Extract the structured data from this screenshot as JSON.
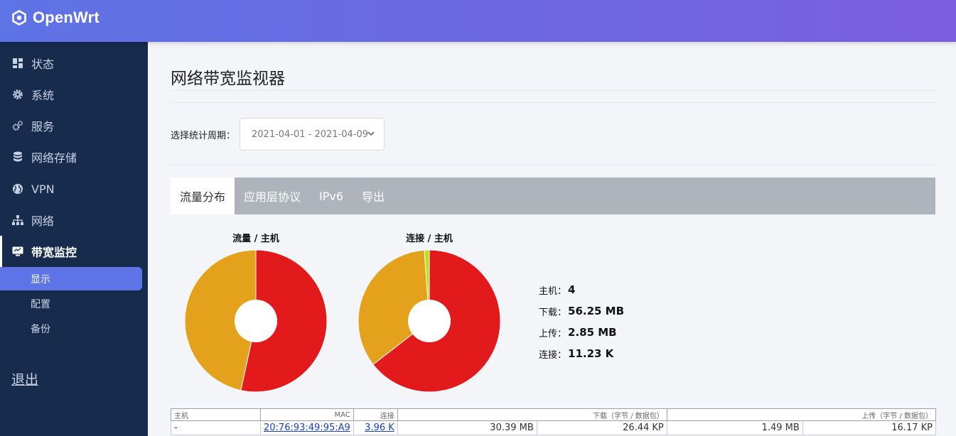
{
  "app": {
    "brand": "OpenWrt"
  },
  "sidebar": {
    "items": [
      {
        "label": "状态",
        "icon": "dashboard-icon"
      },
      {
        "label": "系统",
        "icon": "gear-icon"
      },
      {
        "label": "服务",
        "icon": "gears-icon"
      },
      {
        "label": "网络存储",
        "icon": "database-icon"
      },
      {
        "label": "VPN",
        "icon": "globe-icon"
      },
      {
        "label": "网络",
        "icon": "sitemap-icon"
      },
      {
        "label": "带宽监控",
        "icon": "monitor-icon"
      }
    ],
    "sub_items": [
      {
        "label": "显示"
      },
      {
        "label": "配置"
      },
      {
        "label": "备份"
      }
    ],
    "logout": "退出"
  },
  "page": {
    "title": "网络带宽监视器",
    "period_label": "选择统计周期：",
    "period_value": "2021-04-01 - 2021-04-09",
    "tabs": [
      {
        "label": "流量分布"
      },
      {
        "label": "应用层协议"
      },
      {
        "label": "IPv6"
      },
      {
        "label": "导出"
      }
    ]
  },
  "chart_data": [
    {
      "type": "pie",
      "title": "流量 / 主机",
      "donut": true,
      "slices": [
        {
          "value": 53.4,
          "color": "#e31a1c"
        },
        {
          "value": 46.6,
          "color": "#e4a11b"
        }
      ]
    },
    {
      "type": "pie",
      "title": "连接 / 主机",
      "donut": true,
      "slices": [
        {
          "value": 64.5,
          "color": "#e31a1c"
        },
        {
          "value": 34.4,
          "color": "#e4a11b"
        },
        {
          "value": 1.1,
          "color": "#b5e21b"
        }
      ]
    }
  ],
  "stats": [
    {
      "label": "主机：",
      "value": "4"
    },
    {
      "label": "下载：",
      "value": "56.25 MB"
    },
    {
      "label": "上传：",
      "value": "2.85 MB"
    },
    {
      "label": "连接：",
      "value": "11.23 K"
    }
  ],
  "table": {
    "headers": {
      "host": "主机",
      "mac": "MAC",
      "conn": "连接",
      "down": "下载（字节 / 数据包）",
      "up": "上传（字节 / 数据包）"
    },
    "rows": [
      {
        "host": "-",
        "mac": "20:76:93:49:95:A9",
        "conn": "3.96 K",
        "down_bytes": "30.39 MB",
        "down_pkts": "26.44 KP",
        "up_bytes": "1.49 MB",
        "up_pkts": "16.17 KP"
      }
    ]
  }
}
